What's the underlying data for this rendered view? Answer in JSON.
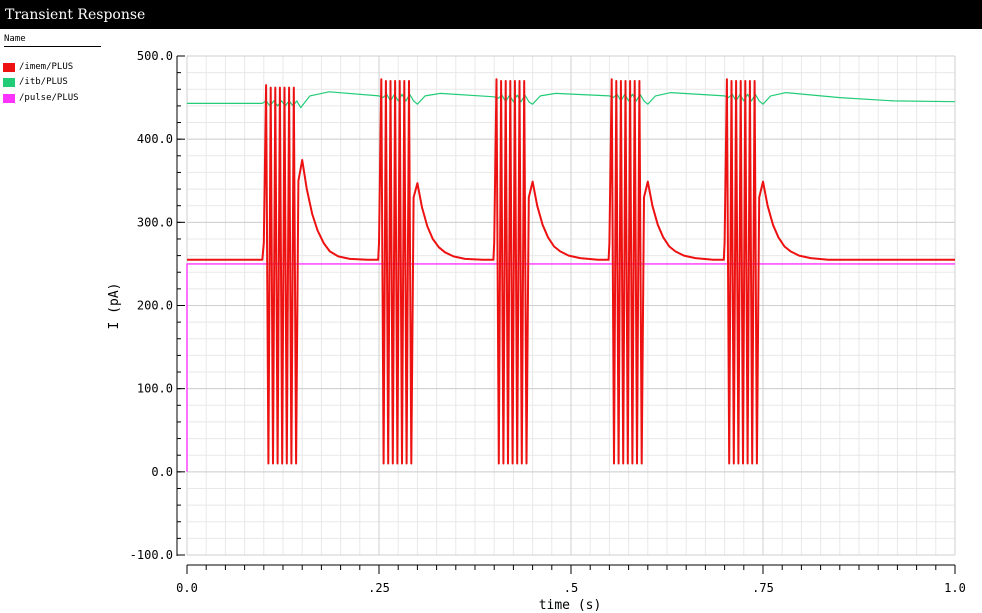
{
  "window": {
    "title": "Transient Response"
  },
  "legend": {
    "header": "Name",
    "items": [
      {
        "label": "/imem/PLUS",
        "color": "#ee1111"
      },
      {
        "label": "/itb/PLUS",
        "color": "#22cc77"
      },
      {
        "label": "/pulse/PLUS",
        "color": "#ff33ff"
      }
    ]
  },
  "chart_data": {
    "type": "line",
    "xlabel": "time (s)",
    "ylabel": "I (pA)",
    "xlim": [
      0,
      1.0
    ],
    "ylim": [
      -100,
      500
    ],
    "grid": true,
    "legend_placement": "left",
    "x_ticks": [
      {
        "value": 0.0,
        "label": "0.0"
      },
      {
        "value": 0.25,
        "label": ".25"
      },
      {
        "value": 0.5,
        "label": ".5"
      },
      {
        "value": 0.75,
        "label": ".75"
      },
      {
        "value": 1.0,
        "label": "1.0"
      }
    ],
    "y_ticks": [
      {
        "value": 500,
        "label": "500.0"
      },
      {
        "value": 400,
        "label": "400.0"
      },
      {
        "value": 300,
        "label": "300.0"
      },
      {
        "value": 200,
        "label": "200.0"
      },
      {
        "value": 100,
        "label": "100.0"
      },
      {
        "value": 0,
        "label": "0.0"
      },
      {
        "value": -100,
        "label": "-100.0"
      }
    ],
    "series": [
      {
        "name": "/pulse/PLUS",
        "color": "#ff33ff",
        "x": [
          0.0,
          0.0,
          1.0
        ],
        "y": [
          0,
          250,
          250
        ]
      },
      {
        "name": "/itb/PLUS",
        "color": "#22cc77",
        "x": [
          0.0,
          0.098,
          0.103,
          0.108,
          0.113,
          0.118,
          0.123,
          0.128,
          0.133,
          0.138,
          0.143,
          0.148,
          0.16,
          0.185,
          0.25,
          0.255,
          0.26,
          0.265,
          0.27,
          0.275,
          0.28,
          0.285,
          0.29,
          0.295,
          0.3,
          0.31,
          0.33,
          0.4,
          0.405,
          0.41,
          0.415,
          0.42,
          0.425,
          0.43,
          0.435,
          0.44,
          0.445,
          0.45,
          0.46,
          0.48,
          0.55,
          0.555,
          0.56,
          0.565,
          0.57,
          0.575,
          0.58,
          0.585,
          0.59,
          0.595,
          0.6,
          0.61,
          0.63,
          0.7,
          0.705,
          0.71,
          0.715,
          0.72,
          0.725,
          0.73,
          0.735,
          0.74,
          0.745,
          0.75,
          0.76,
          0.78,
          0.85,
          0.92,
          1.0
        ],
        "y": [
          443,
          443,
          446,
          440,
          446,
          440,
          446,
          440,
          446,
          440,
          446,
          438,
          452,
          457,
          452,
          450,
          454,
          446,
          454,
          446,
          454,
          446,
          454,
          446,
          442,
          452,
          455,
          451,
          449,
          453,
          445,
          453,
          445,
          453,
          445,
          453,
          445,
          442,
          452,
          455,
          452,
          450,
          454,
          446,
          454,
          446,
          454,
          446,
          454,
          446,
          442,
          452,
          456,
          452,
          450,
          454,
          446,
          454,
          446,
          454,
          446,
          454,
          446,
          442,
          452,
          456,
          450,
          446,
          445
        ]
      },
      {
        "name": "/imem/PLUS",
        "color": "#ee1111",
        "x": [
          0.0,
          0.098,
          0.1,
          0.103,
          0.106,
          0.109,
          0.112,
          0.115,
          0.118,
          0.121,
          0.124,
          0.127,
          0.13,
          0.133,
          0.136,
          0.139,
          0.142,
          0.145,
          0.15,
          0.156,
          0.163,
          0.17,
          0.178,
          0.186,
          0.197,
          0.212,
          0.235,
          0.249,
          0.25,
          0.253,
          0.256,
          0.259,
          0.262,
          0.265,
          0.268,
          0.271,
          0.274,
          0.277,
          0.28,
          0.283,
          0.286,
          0.289,
          0.292,
          0.295,
          0.3,
          0.306,
          0.313,
          0.32,
          0.328,
          0.336,
          0.347,
          0.362,
          0.385,
          0.399,
          0.4,
          0.403,
          0.406,
          0.409,
          0.412,
          0.415,
          0.418,
          0.421,
          0.424,
          0.427,
          0.43,
          0.433,
          0.436,
          0.439,
          0.442,
          0.445,
          0.45,
          0.456,
          0.463,
          0.47,
          0.478,
          0.486,
          0.497,
          0.512,
          0.535,
          0.549,
          0.55,
          0.553,
          0.556,
          0.559,
          0.562,
          0.565,
          0.568,
          0.571,
          0.574,
          0.577,
          0.58,
          0.583,
          0.586,
          0.589,
          0.592,
          0.595,
          0.6,
          0.606,
          0.613,
          0.62,
          0.628,
          0.636,
          0.647,
          0.662,
          0.685,
          0.699,
          0.7,
          0.703,
          0.706,
          0.709,
          0.712,
          0.715,
          0.718,
          0.721,
          0.724,
          0.727,
          0.73,
          0.733,
          0.736,
          0.739,
          0.742,
          0.745,
          0.75,
          0.756,
          0.763,
          0.77,
          0.778,
          0.786,
          0.797,
          0.812,
          0.835,
          0.9,
          1.0
        ],
        "y": [
          255,
          255,
          275,
          465,
          10,
          462,
          10,
          462,
          10,
          462,
          10,
          462,
          10,
          462,
          10,
          462,
          10,
          350,
          375,
          340,
          310,
          290,
          275,
          265,
          259,
          256,
          255,
          255,
          275,
          472,
          10,
          470,
          10,
          470,
          10,
          470,
          10,
          470,
          10,
          470,
          10,
          470,
          10,
          330,
          347,
          318,
          295,
          280,
          270,
          264,
          259,
          256,
          255,
          255,
          275,
          472,
          10,
          470,
          10,
          470,
          10,
          470,
          10,
          470,
          10,
          470,
          10,
          470,
          10,
          330,
          349,
          320,
          297,
          282,
          271,
          265,
          260,
          257,
          255,
          255,
          275,
          472,
          10,
          470,
          10,
          470,
          10,
          470,
          10,
          470,
          10,
          470,
          10,
          470,
          10,
          330,
          349,
          320,
          297,
          282,
          271,
          265,
          260,
          257,
          255,
          255,
          275,
          472,
          10,
          470,
          10,
          470,
          10,
          470,
          10,
          470,
          10,
          470,
          10,
          470,
          10,
          330,
          349,
          320,
          297,
          282,
          271,
          265,
          260,
          257,
          255,
          255,
          255
        ]
      }
    ]
  }
}
